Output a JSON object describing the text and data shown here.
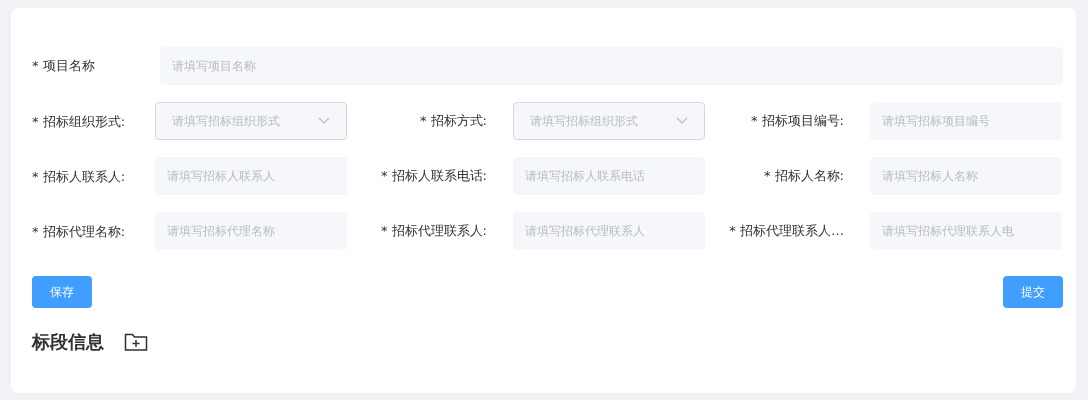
{
  "project_name": {
    "label": "* 项目名称",
    "placeholder": "请填写项目名称"
  },
  "fields": [
    {
      "label": "* 招标组织形式:",
      "placeholder": "请填写招标组织形式",
      "kind": "select"
    },
    {
      "label": "* 招标方式:",
      "placeholder": "请填写招标组织形式",
      "kind": "select"
    },
    {
      "label": "* 招标项目编号:",
      "placeholder": "请填写招标项目编号",
      "kind": "input"
    },
    {
      "label": "* 招标人联系人:",
      "placeholder": "请填写招标人联系人",
      "kind": "input"
    },
    {
      "label": "* 招标人联系电话:",
      "placeholder": "请填写招标人联系电话",
      "kind": "input"
    },
    {
      "label": "* 招标人名称:",
      "placeholder": "请填写招标人名称",
      "kind": "input"
    },
    {
      "label": "* 招标代理名称:",
      "placeholder": "请填写招标代理名称",
      "kind": "input"
    },
    {
      "label": "* 招标代理联系人:",
      "placeholder": "请填写招标代理联系人",
      "kind": "input"
    },
    {
      "label": "* 招标代理联系人…",
      "placeholder": "请填写招标代理联系人电",
      "kind": "input"
    }
  ],
  "buttons": {
    "save": "保存",
    "submit": "提交"
  },
  "section": {
    "title": "标段信息"
  }
}
